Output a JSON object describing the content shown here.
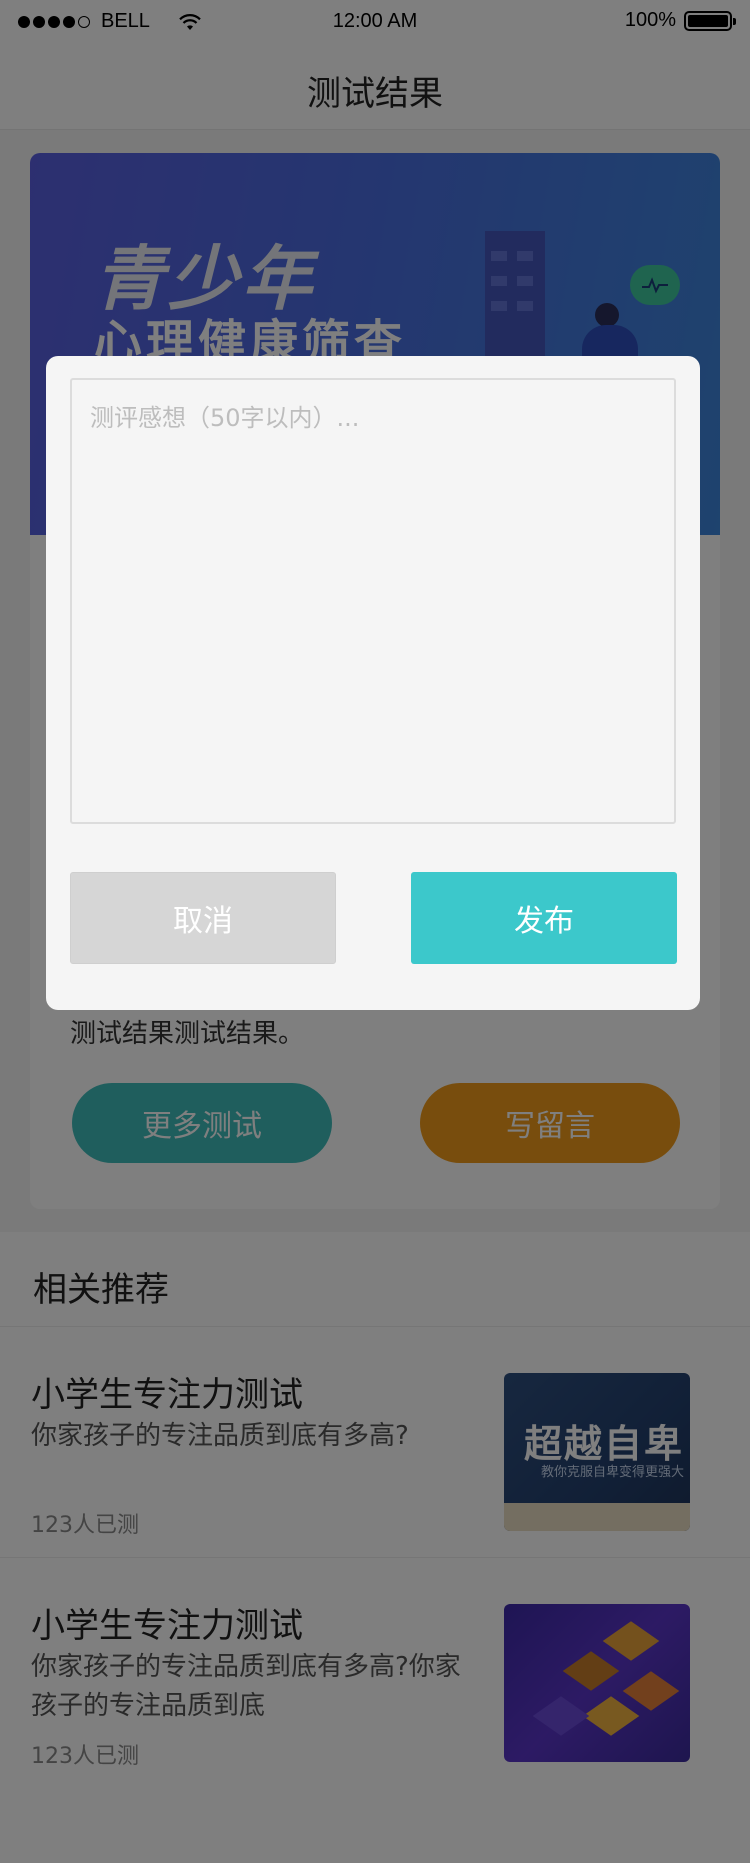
{
  "status_bar": {
    "carrier": "BELL",
    "time": "12:00 AM",
    "battery": "100%",
    "signal_icon": "signal-dots-icon",
    "wifi_icon": "wifi-icon",
    "battery_icon": "battery-icon"
  },
  "header": {
    "title": "测试结果"
  },
  "banner": {
    "title_line1": "青少年",
    "title_line2": "心理健康筛查"
  },
  "result": {
    "text": "测试结果测试结果。",
    "more_tests_label": "更多测试",
    "write_comment_label": "写留言"
  },
  "recommendations": {
    "heading": "相关推荐",
    "items": [
      {
        "title": "小学生专注力测试",
        "desc": "你家孩子的专注品质到底有多高?",
        "count": "123人已测",
        "thumb_title": "超越自卑",
        "thumb_subtitle": "教你克服自卑变得更强大"
      },
      {
        "title": "小学生专注力测试",
        "desc": "你家孩子的专注品质到底有多高?你家孩子的专注品质到底",
        "count": "123人已测"
      }
    ]
  },
  "dialog": {
    "placeholder": "测评感想（50字以内）...",
    "value": "",
    "cancel_label": "取消",
    "publish_label": "发布"
  },
  "colors": {
    "teal": "#3cc8cb",
    "orange": "#f19b1a",
    "overlay": "rgba(0,0,0,0.5)",
    "banner_blue": "#4a6ce0"
  }
}
